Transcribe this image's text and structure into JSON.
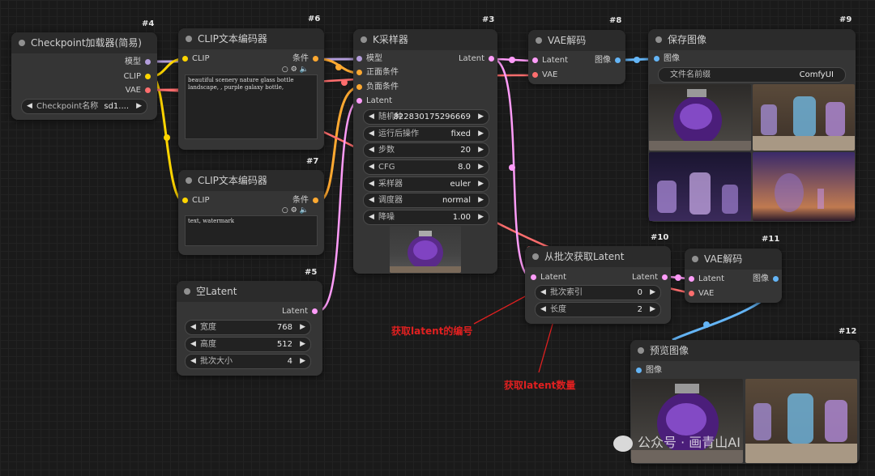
{
  "nodes": {
    "checkpoint": {
      "id": "#4",
      "title": "Checkpoint加载器(简易)",
      "out_model": "模型",
      "out_clip": "CLIP",
      "out_vae": "VAE",
      "w_label": "Checkpoint名称",
      "w_value": "sd1...."
    },
    "clip6": {
      "id": "#6",
      "title": "CLIP文本编码器",
      "in_clip": "CLIP",
      "out_cond": "条件",
      "text": "beautiful scenery nature glass bottle landscape, , purple galaxy bottle,"
    },
    "clip7": {
      "id": "#7",
      "title": "CLIP文本编码器",
      "in_clip": "CLIP",
      "out_cond": "条件",
      "text": "text, watermark"
    },
    "latent5": {
      "id": "#5",
      "title": "空Latent",
      "out_latent": "Latent",
      "widgets": [
        {
          "label": "宽度",
          "value": "768"
        },
        {
          "label": "高度",
          "value": "512"
        },
        {
          "label": "批次大小",
          "value": "4"
        }
      ]
    },
    "ksampler": {
      "id": "#3",
      "title": "K采样器",
      "in_model": "模型",
      "in_pos": "正面条件",
      "in_neg": "负面条件",
      "in_latent": "Latent",
      "out_latent": "Latent",
      "widgets": [
        {
          "label": "随机种",
          "value": "822830175296669"
        },
        {
          "label": "运行后操作",
          "value": "fixed"
        },
        {
          "label": "步数",
          "value": "20"
        },
        {
          "label": "CFG",
          "value": "8.0"
        },
        {
          "label": "采样器",
          "value": "euler"
        },
        {
          "label": "调度器",
          "value": "normal"
        },
        {
          "label": "降噪",
          "value": "1.00"
        }
      ]
    },
    "vae8": {
      "id": "#8",
      "title": "VAE解码",
      "in_latent": "Latent",
      "in_vae": "VAE",
      "out_image": "图像"
    },
    "save9": {
      "id": "#9",
      "title": "保存图像",
      "in_image": "图像",
      "w_label": "文件名前缀",
      "w_value": "ComfyUI"
    },
    "batch10": {
      "id": "#10",
      "title": "从批次获取Latent",
      "in_latent": "Latent",
      "out_latent": "Latent",
      "widgets": [
        {
          "label": "批次索引",
          "value": "0"
        },
        {
          "label": "长度",
          "value": "2"
        }
      ]
    },
    "vae11": {
      "id": "#11",
      "title": "VAE解码",
      "in_latent": "Latent",
      "in_vae": "VAE",
      "out_image": "图像"
    },
    "preview12": {
      "id": "#12",
      "title": "预览图像",
      "in_image": "图像"
    }
  },
  "annotations": {
    "index_note": "获取latent的编号",
    "count_note": "获取latent数量"
  },
  "watermark": "公众号 · 画青山AI",
  "colors": {
    "model": "#b39ddb",
    "clip": "#ffd500",
    "vae": "#ff6e6e",
    "cond": "#ffa931",
    "latent": "#ff9cf9",
    "image": "#64b5f6",
    "annot": "#e02020"
  }
}
